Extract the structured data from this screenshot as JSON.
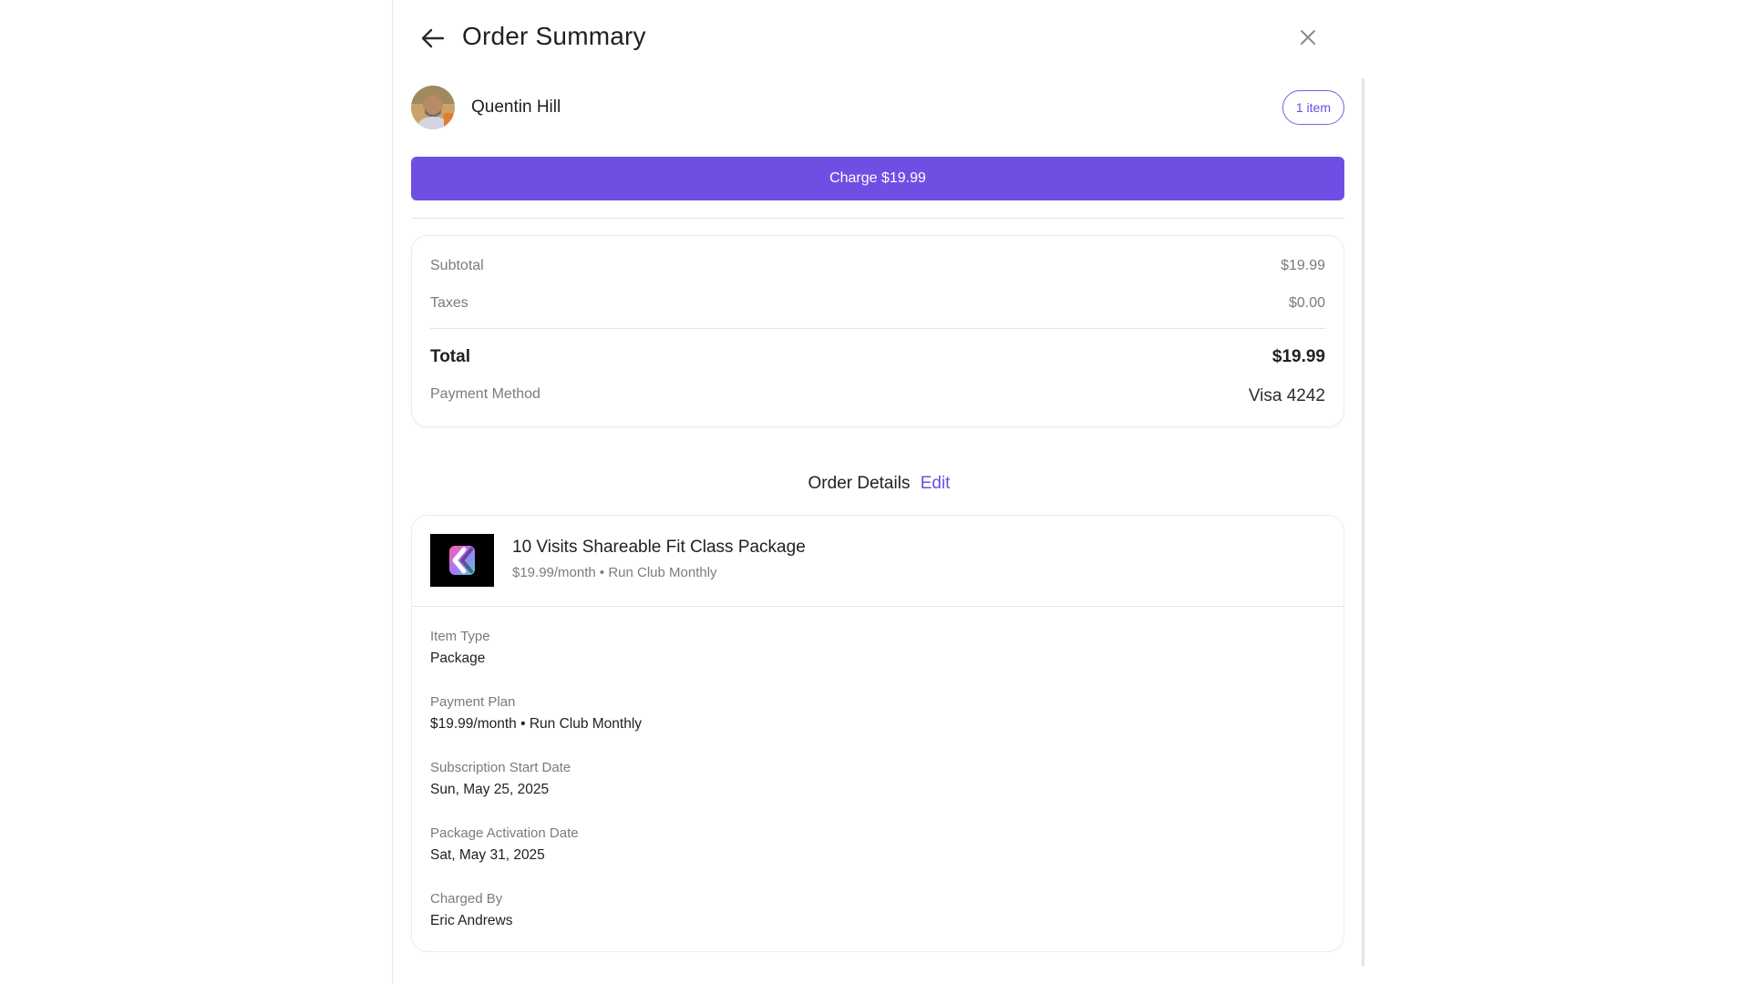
{
  "header": {
    "title": "Order Summary",
    "back_icon": "arrow-left-icon",
    "close_icon": "close-icon"
  },
  "customer": {
    "name": "Quentin Hill",
    "items_badge": "1 item"
  },
  "charge_button": {
    "label": "Charge $19.99"
  },
  "totals": {
    "subtotal_label": "Subtotal",
    "subtotal_value": "$19.99",
    "taxes_label": "Taxes",
    "taxes_value": "$0.00",
    "total_label": "Total",
    "total_value": "$19.99",
    "payment_method_label": "Payment Method",
    "payment_method_value": "Visa 4242"
  },
  "order_details": {
    "title": "Order Details",
    "edit_label": "Edit",
    "product": {
      "name": "10 Visits Shareable Fit Class Package",
      "subtitle": "$19.99/month • Run Club Monthly"
    },
    "fields": [
      {
        "label": "Item Type",
        "value": "Package"
      },
      {
        "label": "Payment Plan",
        "value": "$19.99/month • Run Club Monthly"
      },
      {
        "label": "Subscription Start Date",
        "value": "Sun, May 25, 2025"
      },
      {
        "label": "Package Activation Date",
        "value": "Sat, May 31, 2025"
      },
      {
        "label": "Charged By",
        "value": "Eric Andrews"
      }
    ]
  },
  "colors": {
    "accent": "#6f4fe3",
    "badge_border": "#7c5ce6",
    "muted_text": "#7a7a84"
  }
}
